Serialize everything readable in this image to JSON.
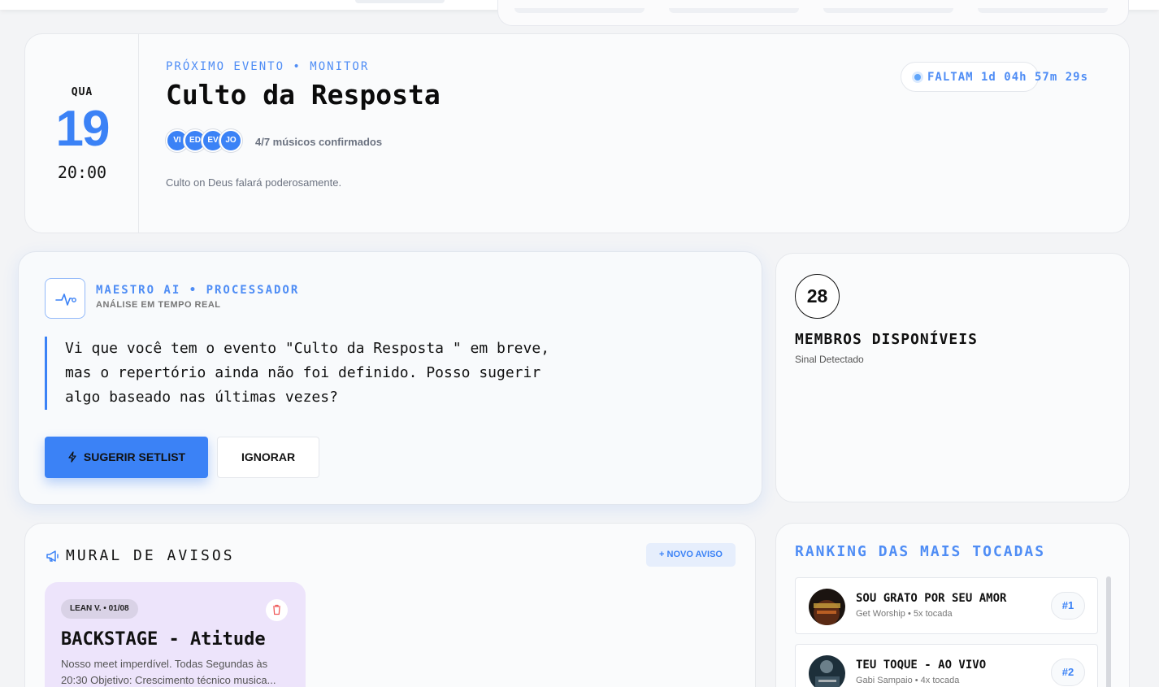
{
  "event": {
    "day_of_week": "QUA",
    "day": "19",
    "time": "20:00",
    "eyebrow": "PRÓXIMO EVENTO • MONITOR",
    "title": "Culto da Resposta",
    "avatars": [
      "VI",
      "ED",
      "EV",
      "JO"
    ],
    "confirmed": "4/7 músicos confirmados",
    "description": "Culto on Deus falará poderosamente.",
    "countdown": "FALTAM 1d 04h 57m 29s"
  },
  "ai": {
    "title": "MAESTRO AI • PROCESSADOR",
    "subtitle": "ANÁLISE EM TEMPO REAL",
    "message": "Vi que você tem o evento \"Culto da Resposta \" em breve, mas o repertório ainda não foi definido. Posso sugerir algo baseado nas últimas vezes?",
    "primary_label": "SUGERIR SETLIST",
    "secondary_label": "IGNORAR"
  },
  "members": {
    "count": "28",
    "title": "MEMBROS DISPONÍVEIS",
    "subtitle": "Sinal Detectado"
  },
  "mural": {
    "title": "MURAL DE AVISOS",
    "new_label": "+ NOVO AVISO",
    "notes": [
      {
        "tag": "LEAN V. • 01/08",
        "title": "BACKSTAGE - Atitude",
        "body_line1": "Nosso meet imperdível. Todas Segundas às",
        "body_line2": "20:30 Objetivo: Crescimento técnico musica..."
      }
    ]
  },
  "ranking": {
    "title": "RANKING DAS MAIS TOCADAS",
    "items": [
      {
        "name": "SOU GRATO POR SEU AMOR",
        "meta": "Get Worship • 5x tocada",
        "position": "#1"
      },
      {
        "name": "TEU TOQUE - AO VIVO",
        "meta": "Gabi Sampaio • 4x tocada",
        "position": "#2"
      }
    ]
  },
  "colors": {
    "accent": "#3b82f6",
    "note_bg": "#ede4fb"
  }
}
